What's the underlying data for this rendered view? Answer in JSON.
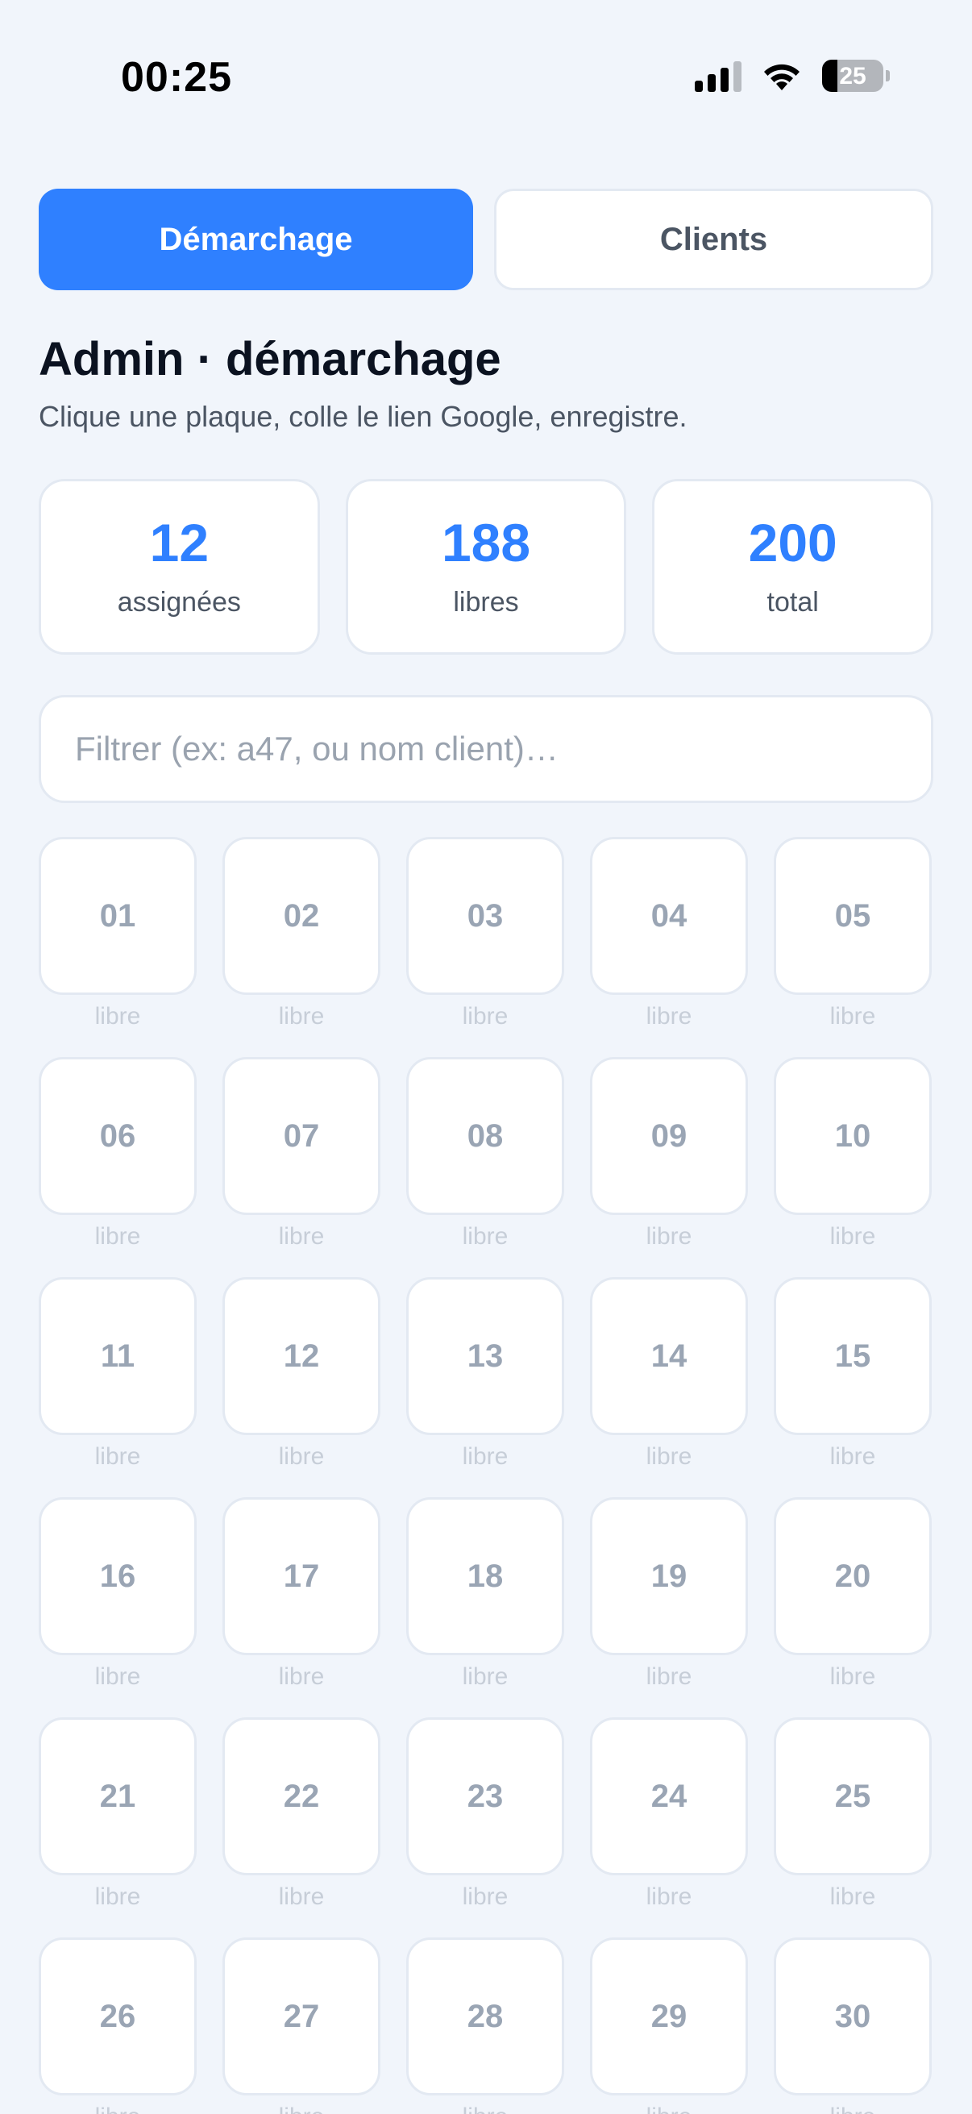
{
  "status_bar": {
    "time": "00:25",
    "battery_level": 25,
    "battery_label": "25",
    "icons": [
      "signal-icon",
      "wifi-icon",
      "battery-icon"
    ]
  },
  "tabs": [
    {
      "label": "Démarchage",
      "active": true
    },
    {
      "label": "Clients",
      "active": false
    }
  ],
  "header": {
    "title": "Admin · démarchage",
    "subtitle": "Clique une plaque, colle le lien Google, enregistre."
  },
  "stats": [
    {
      "value": "12",
      "label": "assignées"
    },
    {
      "value": "188",
      "label": "libres"
    },
    {
      "value": "200",
      "label": "total"
    }
  ],
  "filter": {
    "placeholder": "Filtrer (ex: a47, ou nom client)…",
    "value": ""
  },
  "plates": [
    {
      "number": "01",
      "status": "libre"
    },
    {
      "number": "02",
      "status": "libre"
    },
    {
      "number": "03",
      "status": "libre"
    },
    {
      "number": "04",
      "status": "libre"
    },
    {
      "number": "05",
      "status": "libre"
    },
    {
      "number": "06",
      "status": "libre"
    },
    {
      "number": "07",
      "status": "libre"
    },
    {
      "number": "08",
      "status": "libre"
    },
    {
      "number": "09",
      "status": "libre"
    },
    {
      "number": "10",
      "status": "libre"
    },
    {
      "number": "11",
      "status": "libre"
    },
    {
      "number": "12",
      "status": "libre"
    },
    {
      "number": "13",
      "status": "libre"
    },
    {
      "number": "14",
      "status": "libre"
    },
    {
      "number": "15",
      "status": "libre"
    },
    {
      "number": "16",
      "status": "libre"
    },
    {
      "number": "17",
      "status": "libre"
    },
    {
      "number": "18",
      "status": "libre"
    },
    {
      "number": "19",
      "status": "libre"
    },
    {
      "number": "20",
      "status": "libre"
    },
    {
      "number": "21",
      "status": "libre"
    },
    {
      "number": "22",
      "status": "libre"
    },
    {
      "number": "23",
      "status": "libre"
    },
    {
      "number": "24",
      "status": "libre"
    },
    {
      "number": "25",
      "status": "libre"
    },
    {
      "number": "26",
      "status": "libre"
    },
    {
      "number": "27",
      "status": "libre"
    },
    {
      "number": "28",
      "status": "libre"
    },
    {
      "number": "29",
      "status": "libre"
    },
    {
      "number": "30",
      "status": "libre"
    }
  ],
  "colors": {
    "accent": "#2f80ff",
    "background": "#f1f5fb",
    "card": "#ffffff",
    "border": "#e3e9f2",
    "plate_text": "#9aa5b4",
    "plate_status": "#c7ced8"
  }
}
